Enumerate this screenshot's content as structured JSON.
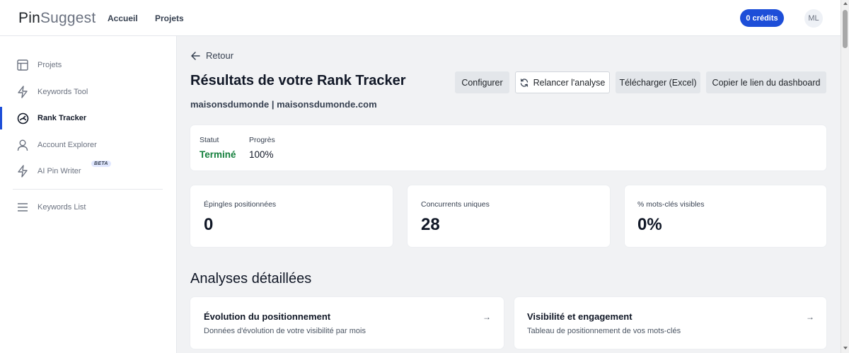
{
  "header": {
    "logo_part1": "Pin",
    "logo_part2": "Suggest",
    "nav": [
      "Accueil",
      "Projets"
    ],
    "credits_label": "0 crédits",
    "avatar_initials": "ML"
  },
  "sidebar": {
    "items": [
      {
        "label": "Projets",
        "icon": "layout-icon",
        "active": false
      },
      {
        "label": "Keywords Tool",
        "icon": "bolt-icon",
        "active": false
      },
      {
        "label": "Rank Tracker",
        "icon": "gauge-icon",
        "active": true
      },
      {
        "label": "Account Explorer",
        "icon": "user-icon",
        "active": false
      },
      {
        "label": "AI Pin Writer",
        "icon": "bolt-icon",
        "active": false,
        "badge": "BETA"
      },
      {
        "label": "Keywords List",
        "icon": "list-icon",
        "active": false
      }
    ]
  },
  "main": {
    "back_label": "Retour",
    "title": "Résultats de votre Rank Tracker",
    "subtitle": "maisonsdumonde | maisonsdumonde.com",
    "actions": {
      "configure": "Configurer",
      "rerun": "Relancer l'analyse",
      "download": "Télécharger (Excel)",
      "copy_link": "Copier le lien du dashboard"
    },
    "status_card": {
      "status_label": "Statut",
      "status_value": "Terminé",
      "progress_label": "Progrès",
      "progress_value": "100%"
    },
    "stats": [
      {
        "label": "Épingles positionnées",
        "value": "0"
      },
      {
        "label": "Concurrents uniques",
        "value": "28"
      },
      {
        "label": "% mots-clés visibles",
        "value": "0%"
      }
    ],
    "analyses_title": "Analyses détaillées",
    "analyses": [
      {
        "title": "Évolution du positionnement",
        "desc": "Données d'évolution de votre visibilité par mois",
        "arrow": "→"
      },
      {
        "title": "Visibilité et engagement",
        "desc": "Tableau de positionnement de vos mots-clés",
        "arrow": "→"
      }
    ]
  },
  "colors": {
    "accent": "#1d4ed8",
    "success": "#15803d"
  }
}
